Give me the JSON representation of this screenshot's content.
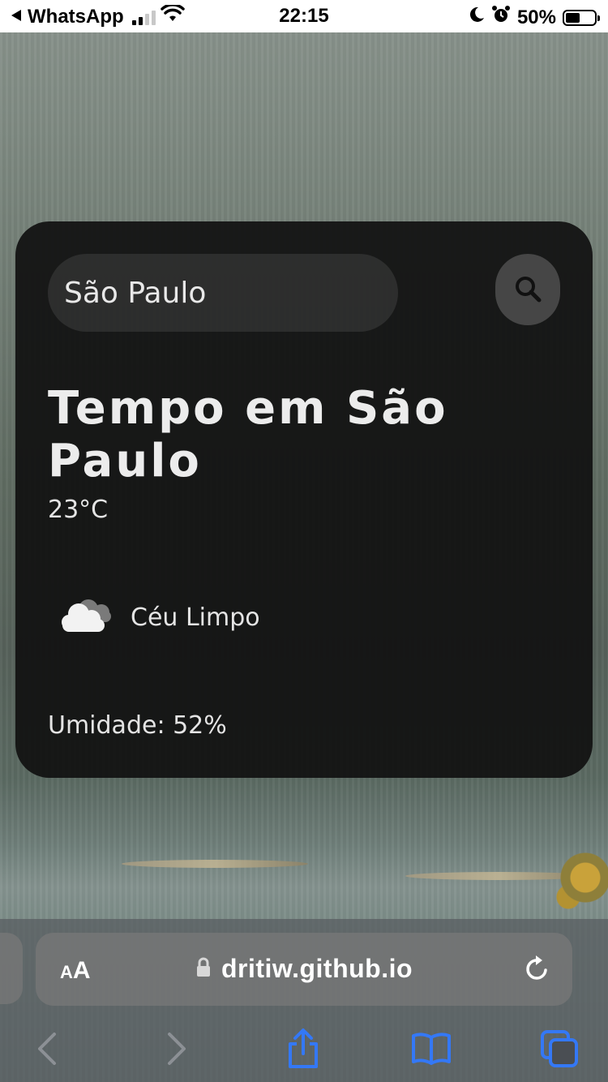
{
  "status_bar": {
    "back_app": "WhatsApp",
    "time": "22:15",
    "battery_percent": "50%",
    "icons": [
      "back-triangle-icon",
      "signal-icon",
      "wifi-icon",
      "moon-icon",
      "alarm-icon",
      "battery-icon"
    ]
  },
  "search": {
    "value": "São Paulo",
    "button_icon": "search-icon"
  },
  "weather": {
    "title": "Tempo em São Paulo",
    "temperature": "23°C",
    "condition": "Céu Limpo",
    "condition_icon": "cloud-icon",
    "humidity": "Umidade: 52%"
  },
  "browser": {
    "text_size_small": "A",
    "text_size_big": "A",
    "url": "dritiw.github.io",
    "icons": [
      "lock-icon",
      "reload-icon",
      "back-icon",
      "forward-icon",
      "share-icon",
      "bookmarks-icon",
      "tabs-icon"
    ]
  },
  "colors": {
    "card_bg": "#111111",
    "accent_blue": "#3478f6"
  }
}
